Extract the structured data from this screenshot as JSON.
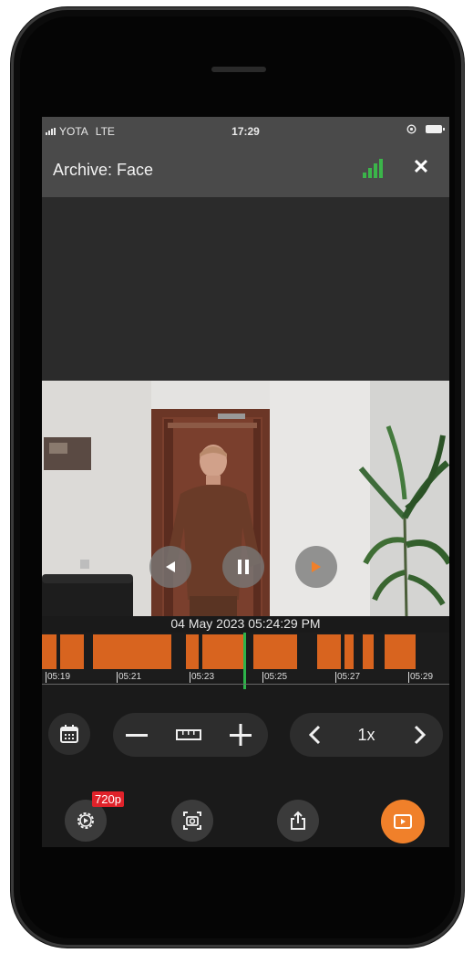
{
  "status_bar": {
    "carrier": "YOTA",
    "network": "LTE",
    "time": "17:29"
  },
  "header": {
    "title": "Archive: Face",
    "close_icon": "close-icon",
    "quality_icon": "signal-quality-icon",
    "quality_color": "#3bb54a"
  },
  "player": {
    "timestamp": "04 May 2023 05:24:29 PM",
    "state": "paused"
  },
  "timeline": {
    "ticks": [
      "05:19",
      "05:21",
      "05:23",
      "05:25",
      "05:27",
      "05:29"
    ],
    "segment_color": "#d8641f",
    "cursor_color": "#2db34a"
  },
  "controls": {
    "speed": "1x",
    "calendar_icon": "calendar-icon",
    "zoom_out_icon": "minus-icon",
    "ruler_icon": "ruler-icon",
    "zoom_in_icon": "plus-icon",
    "prev_icon": "chevron-left-icon",
    "next_icon": "chevron-right-icon"
  },
  "bottom_bar": {
    "quality_badge": "720p",
    "settings_icon": "settings-icon",
    "snapshot_icon": "camera-icon",
    "share_icon": "share-icon",
    "live_icon": "play-video-icon",
    "accent_color": "#f0802a"
  }
}
